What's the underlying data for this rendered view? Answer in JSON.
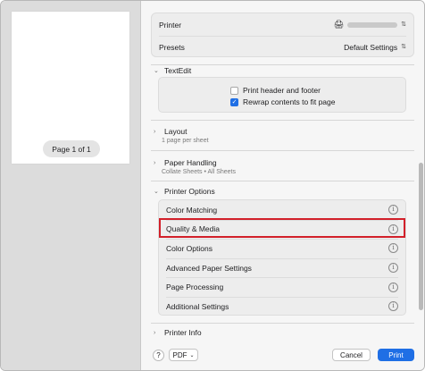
{
  "preview": {
    "page_indicator": "Page 1 of 1"
  },
  "header": {
    "printer_label": "Printer",
    "presets_label": "Presets",
    "presets_value": "Default Settings"
  },
  "textedit": {
    "title": "TextEdit",
    "print_header_footer": {
      "label": "Print header and footer",
      "checked": false
    },
    "rewrap": {
      "label": "Rewrap contents to fit page",
      "checked": true
    }
  },
  "layout": {
    "title": "Layout",
    "summary": "1 page per sheet"
  },
  "paper_handling": {
    "title": "Paper Handling",
    "summary": "Collate Sheets • All Sheets"
  },
  "printer_options": {
    "title": "Printer Options",
    "items": [
      {
        "label": "Color Matching"
      },
      {
        "label": "Quality & Media",
        "highlighted": true
      },
      {
        "label": "Color Options"
      },
      {
        "label": "Advanced Paper Settings"
      },
      {
        "label": "Page Processing"
      },
      {
        "label": "Additional Settings"
      }
    ]
  },
  "printer_info": {
    "title": "Printer Info"
  },
  "footer": {
    "help": "?",
    "pdf_label": "PDF",
    "cancel_label": "Cancel",
    "print_label": "Print"
  },
  "colors": {
    "accent": "#1f6fe5",
    "highlight": "#d2202a"
  }
}
